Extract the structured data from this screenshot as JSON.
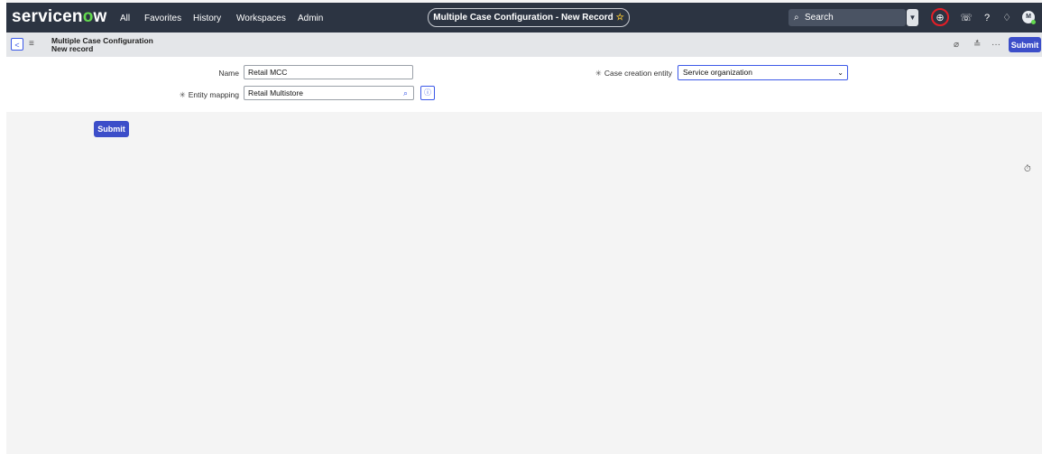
{
  "app": {
    "logo_text_a": "servicen",
    "logo_text_o": "o",
    "logo_text_b": "w"
  },
  "nav": [
    "All",
    "Favorites",
    "History",
    "Workspaces",
    "Admin"
  ],
  "record_title": "Multiple Case Configuration - New Record",
  "search": {
    "label": "Search",
    "icon": "search-icon"
  },
  "top_icons": [
    "globe-icon",
    "chat-icon",
    "help-icon",
    "bell-icon"
  ],
  "user": {
    "avatar_initial": "M",
    "status_color": "#62d84e"
  },
  "breadcrumb": {
    "table": "Multiple Case Configuration",
    "record": "New record"
  },
  "header_icons": [
    "attachment-icon",
    "settings-icon",
    "more-icon"
  ],
  "buttons": {
    "submit": "Submit"
  },
  "form": {
    "name": {
      "label": "Name",
      "value": "Retail MCC"
    },
    "entity_mapping": {
      "label": "Entity mapping",
      "value": "Retail Multistore",
      "required": true
    },
    "case_creation_entity": {
      "label": "Case creation entity",
      "value": "Service organization",
      "required": true
    }
  },
  "colors": {
    "nav_bg": "#2c3442",
    "accent": "#3c4ec9",
    "highlight_ring": "#e41e26"
  }
}
